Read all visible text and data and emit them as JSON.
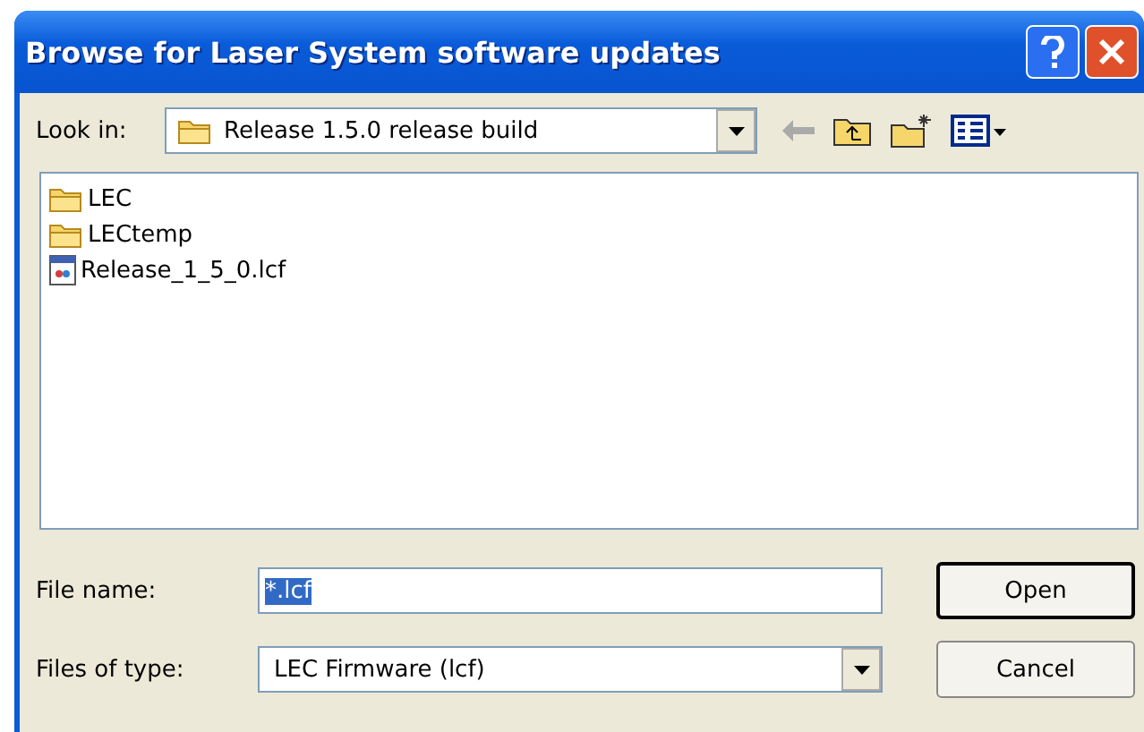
{
  "window": {
    "title": "Browse for Laser System software updates"
  },
  "look_in": {
    "label": "Look in:",
    "value": "Release 1.5.0 release build"
  },
  "files": [
    {
      "name": "LEC",
      "kind": "folder"
    },
    {
      "name": "LECtemp",
      "kind": "folder"
    },
    {
      "name": "Release_1_5_0.lcf",
      "kind": "file"
    }
  ],
  "file_name": {
    "label": "File name:",
    "value": "*.lcf",
    "value_selected": true
  },
  "file_type": {
    "label": "Files of type:",
    "value": "LEC Firmware (lcf)"
  },
  "buttons": [
    {
      "label": "Open",
      "default": true
    },
    {
      "label": "Cancel",
      "default": false
    }
  ]
}
